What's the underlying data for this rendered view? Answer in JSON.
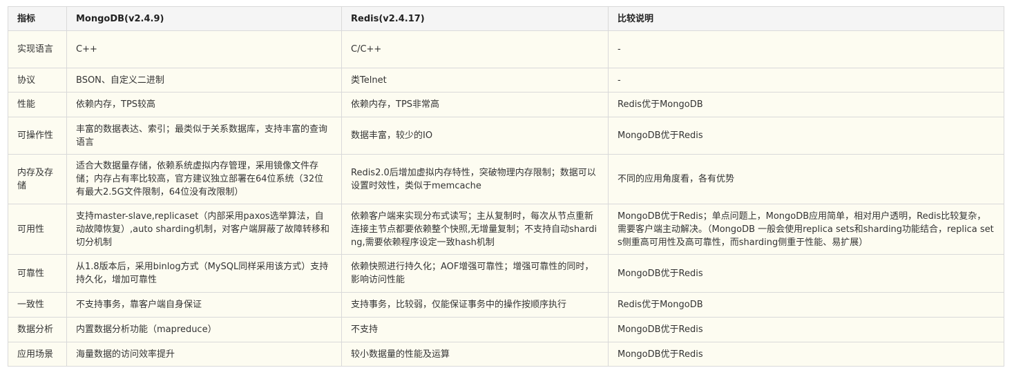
{
  "headers": [
    "指标",
    "MongoDB(v2.4.9)",
    "Redis(v2.4.17)",
    "比较说明"
  ],
  "rows": [
    [
      "实现语言",
      "C++",
      "C/C++",
      "-"
    ],
    [
      "协议",
      "BSON、自定义二进制",
      "类Telnet",
      "-"
    ],
    [
      "性能",
      "依赖内存，TPS较高",
      "依赖内存，TPS非常高",
      "Redis优于MongoDB"
    ],
    [
      "可操作性",
      "丰富的数据表达、索引；最类似于关系数据库，支持丰富的查询语言",
      "数据丰富，较少的IO",
      "MongoDB优于Redis"
    ],
    [
      "内存及存储",
      "适合大数据量存储，依赖系统虚拟内存管理，采用镜像文件存储；内存占有率比较高，官方建议独立部署在64位系统（32位有最大2.5G文件限制，64位没有改限制）",
      "Redis2.0后增加虚拟内存特性，突破物理内存限制；数据可以设置时效性，类似于memcache",
      "不同的应用角度看，各有优势"
    ],
    [
      "可用性",
      "支持master-slave,replicaset（内部采用paxos选举算法，自动故障恢复）,auto sharding机制，对客户端屏蔽了故障转移和切分机制",
      "依赖客户端来实现分布式读写；主从复制时，每次从节点重新连接主节点都要依赖整个快照,无增量复制；不支持自动sharding,需要依赖程序设定一致hash机制",
      "MongoDB优于Redis；单点问题上，MongoDB应用简单，相对用户透明，Redis比较复杂，需要客户端主动解决。（MongoDB 一般会使用replica sets和sharding功能结合，replica sets侧重高可用性及高可靠性，而sharding侧重于性能、易扩展）"
    ],
    [
      "可靠性",
      "从1.8版本后，采用binlog方式（MySQL同样采用该方式）支持持久化，增加可靠性",
      "依赖快照进行持久化；AOF增强可靠性；增强可靠性的同时，影响访问性能",
      "MongoDB优于Redis"
    ],
    [
      "一致性",
      "不支持事务，靠客户端自身保证",
      "支持事务，比较弱，仅能保证事务中的操作按顺序执行",
      "Redis优于MongoDB"
    ],
    [
      "数据分析",
      "内置数据分析功能（mapreduce）",
      "不支持",
      "MongoDB优于Redis"
    ],
    [
      "应用场景",
      "海量数据的访问效率提升",
      "较小数据量的性能及运算",
      "MongoDB优于Redis"
    ]
  ]
}
